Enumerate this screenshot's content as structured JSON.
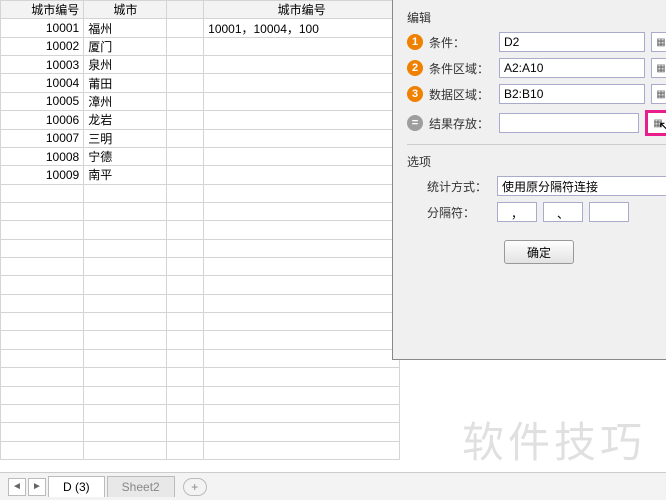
{
  "sheet": {
    "headers": [
      "城市编号",
      "城市",
      "",
      "城市编号"
    ],
    "rows": [
      [
        "10001",
        "福州",
        "",
        "10001，10004，100"
      ],
      [
        "10002",
        "厦门",
        "",
        ""
      ],
      [
        "10003",
        "泉州",
        "",
        ""
      ],
      [
        "10004",
        "莆田",
        "",
        ""
      ],
      [
        "10005",
        "漳州",
        "",
        ""
      ],
      [
        "10006",
        "龙岩",
        "",
        ""
      ],
      [
        "10007",
        "三明",
        "",
        ""
      ],
      [
        "10008",
        "宁德",
        "",
        ""
      ],
      [
        "10009",
        "南平",
        "",
        ""
      ]
    ]
  },
  "dialog": {
    "section_edit": "编辑",
    "labels": {
      "cond": "条件：",
      "cond_range": "条件区域：",
      "data_range": "数据区域：",
      "result_loc": "结果存放："
    },
    "values": {
      "cond": "D2",
      "cond_range": "A2:A10",
      "data_range": "B2:B10",
      "result_loc": ""
    },
    "section_options": "选项",
    "stat_label": "统计方式：",
    "stat_value": "使用原分隔符连接",
    "sep_label": "分隔符：",
    "sep_values": [
      "，",
      "、",
      ""
    ],
    "ok": "确定"
  },
  "tabs": {
    "active": "D (3)",
    "inactive": "Sheet2"
  },
  "watermark": "软件技巧",
  "chart_data": {
    "type": "table",
    "title": "",
    "columns": [
      "城市编号",
      "城市"
    ],
    "rows": [
      {
        "城市编号": 10001,
        "城市": "福州"
      },
      {
        "城市编号": 10002,
        "城市": "厦门"
      },
      {
        "城市编号": 10003,
        "城市": "泉州"
      },
      {
        "城市编号": 10004,
        "城市": "莆田"
      },
      {
        "城市编号": 10005,
        "城市": "漳州"
      },
      {
        "城市编号": 10006,
        "城市": "龙岩"
      },
      {
        "城市编号": 10007,
        "城市": "三明"
      },
      {
        "城市编号": 10008,
        "城市": "宁德"
      },
      {
        "城市编号": 10009,
        "城市": "南平"
      }
    ]
  }
}
